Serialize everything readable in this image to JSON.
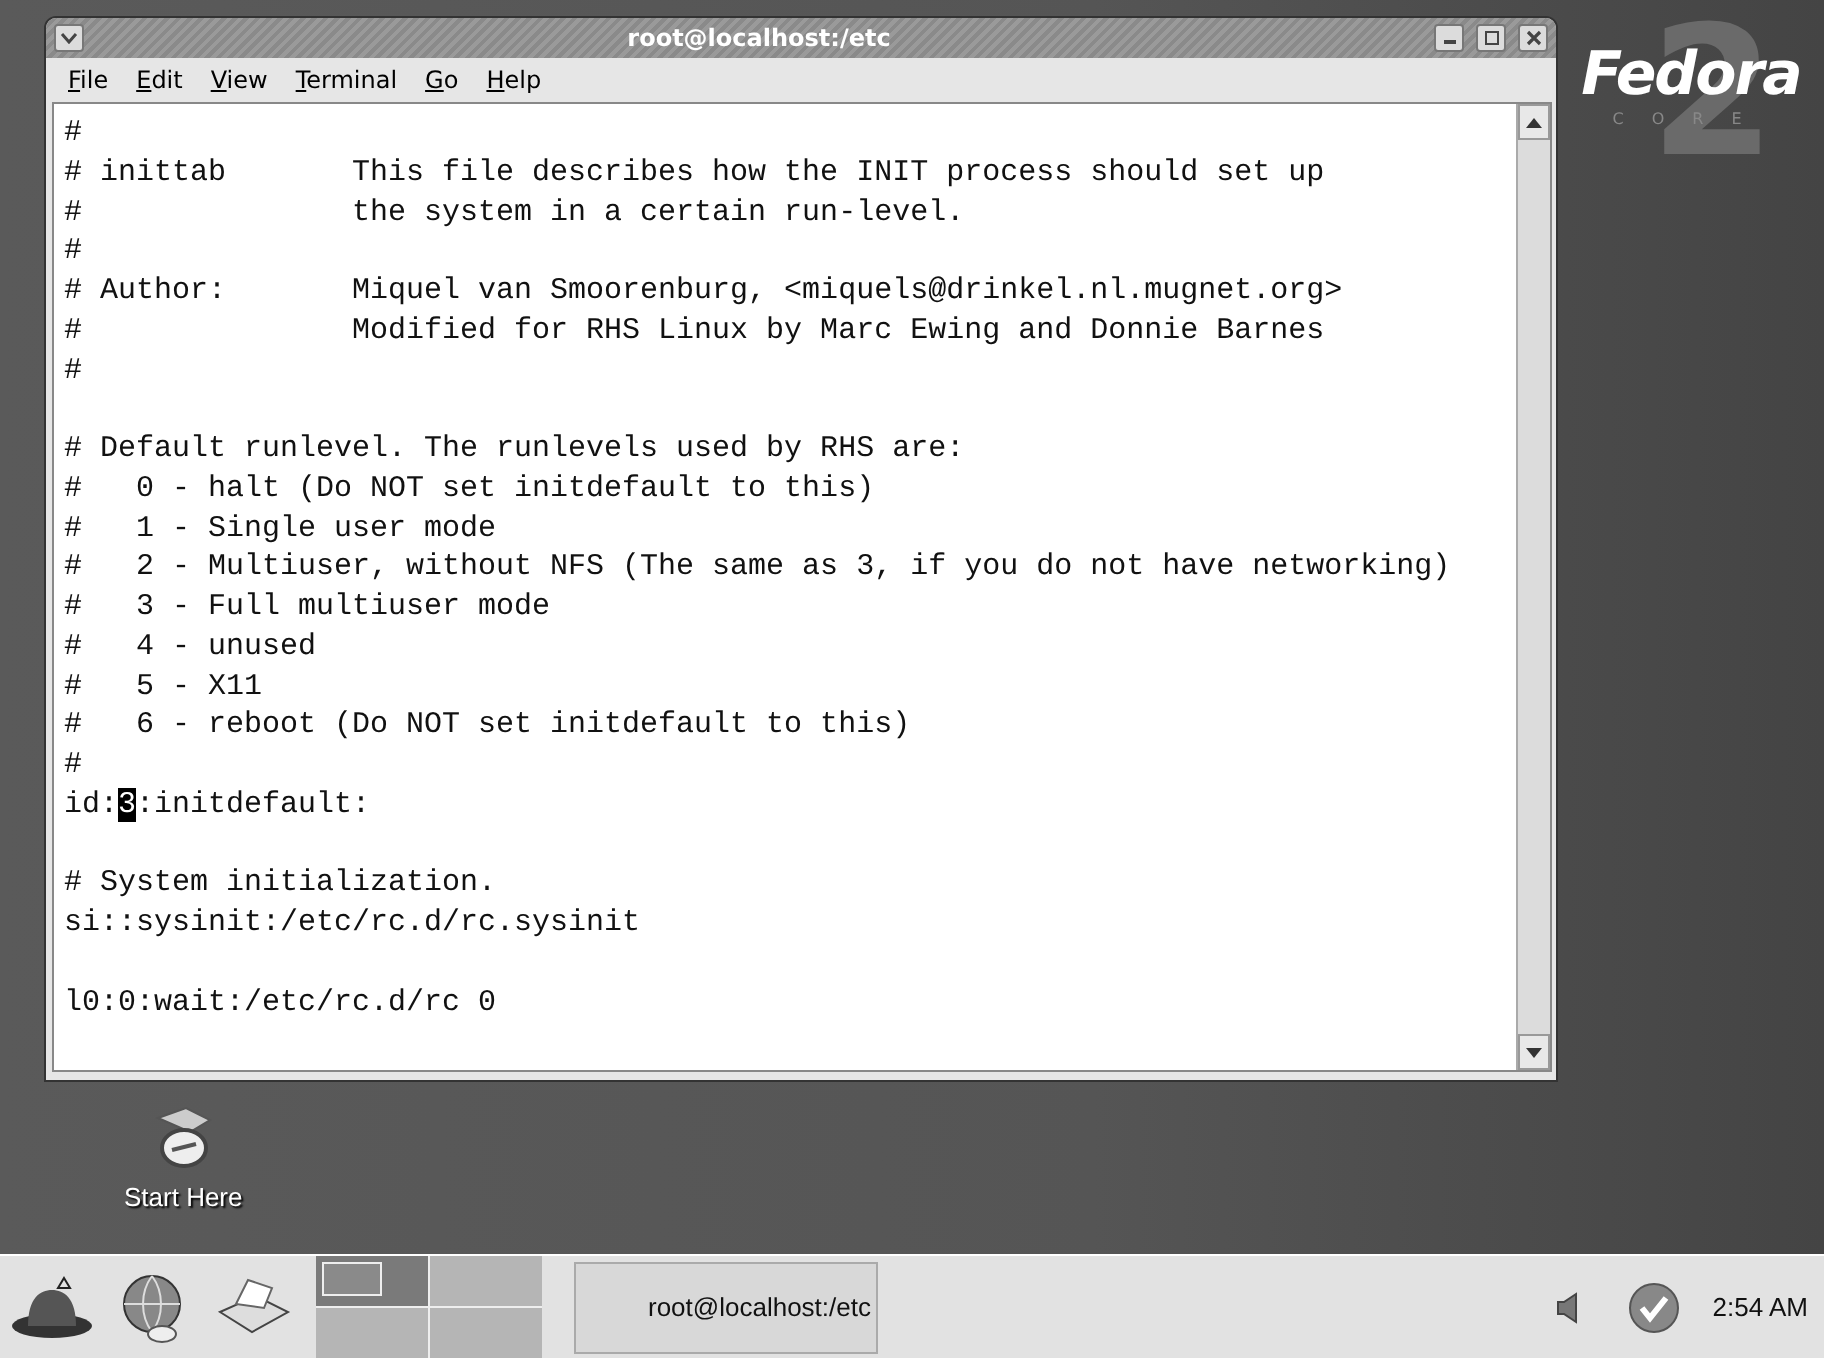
{
  "window": {
    "title": "root@localhost:/etc"
  },
  "menu": [
    "File",
    "Edit",
    "View",
    "Terminal",
    "Go",
    "Help"
  ],
  "terminal": {
    "lines": [
      {
        "kind": "text",
        "text": "#"
      },
      {
        "kind": "text",
        "text": "# inittab       This file describes how the INIT process should set up"
      },
      {
        "kind": "text",
        "text": "#               the system in a certain run-level."
      },
      {
        "kind": "text",
        "text": "#"
      },
      {
        "kind": "text",
        "text": "# Author:       Miquel van Smoorenburg, <miquels@drinkel.nl.mugnet.org>"
      },
      {
        "kind": "text",
        "text": "#               Modified for RHS Linux by Marc Ewing and Donnie Barnes"
      },
      {
        "kind": "text",
        "text": "#"
      },
      {
        "kind": "blank"
      },
      {
        "kind": "text",
        "text": "# Default runlevel. The runlevels used by RHS are:"
      },
      {
        "kind": "text",
        "text": "#   0 - halt (Do NOT set initdefault to this)"
      },
      {
        "kind": "text",
        "text": "#   1 - Single user mode"
      },
      {
        "kind": "text",
        "text": "#   2 - Multiuser, without NFS (The same as 3, if you do not have networking)"
      },
      {
        "kind": "text",
        "text": "#   3 - Full multiuser mode"
      },
      {
        "kind": "text",
        "text": "#   4 - unused"
      },
      {
        "kind": "text",
        "text": "#   5 - X11"
      },
      {
        "kind": "text",
        "text": "#   6 - reboot (Do NOT set initdefault to this)"
      },
      {
        "kind": "text",
        "text": "#"
      },
      {
        "kind": "cursor",
        "before": "id:",
        "cursor": "3",
        "after": ":initdefault:"
      },
      {
        "kind": "blank"
      },
      {
        "kind": "text",
        "text": "# System initialization."
      },
      {
        "kind": "text",
        "text": "si::sysinit:/etc/rc.d/rc.sysinit"
      },
      {
        "kind": "blank"
      },
      {
        "kind": "text",
        "text": "l0:0:wait:/etc/rc.d/rc 0"
      }
    ]
  },
  "logo": {
    "name": "Fedora",
    "subtitle": "CORE",
    "number": "2"
  },
  "desktop_icons": [
    {
      "label": "Start Here"
    }
  ],
  "taskbar": {
    "workspaces": [
      {
        "selected": true
      },
      {
        "selected": false
      },
      {
        "selected": false
      },
      {
        "selected": false
      }
    ],
    "tasks": [
      {
        "label": "root@localhost:/etc",
        "selected": false
      }
    ],
    "clock": "2:54 AM"
  }
}
